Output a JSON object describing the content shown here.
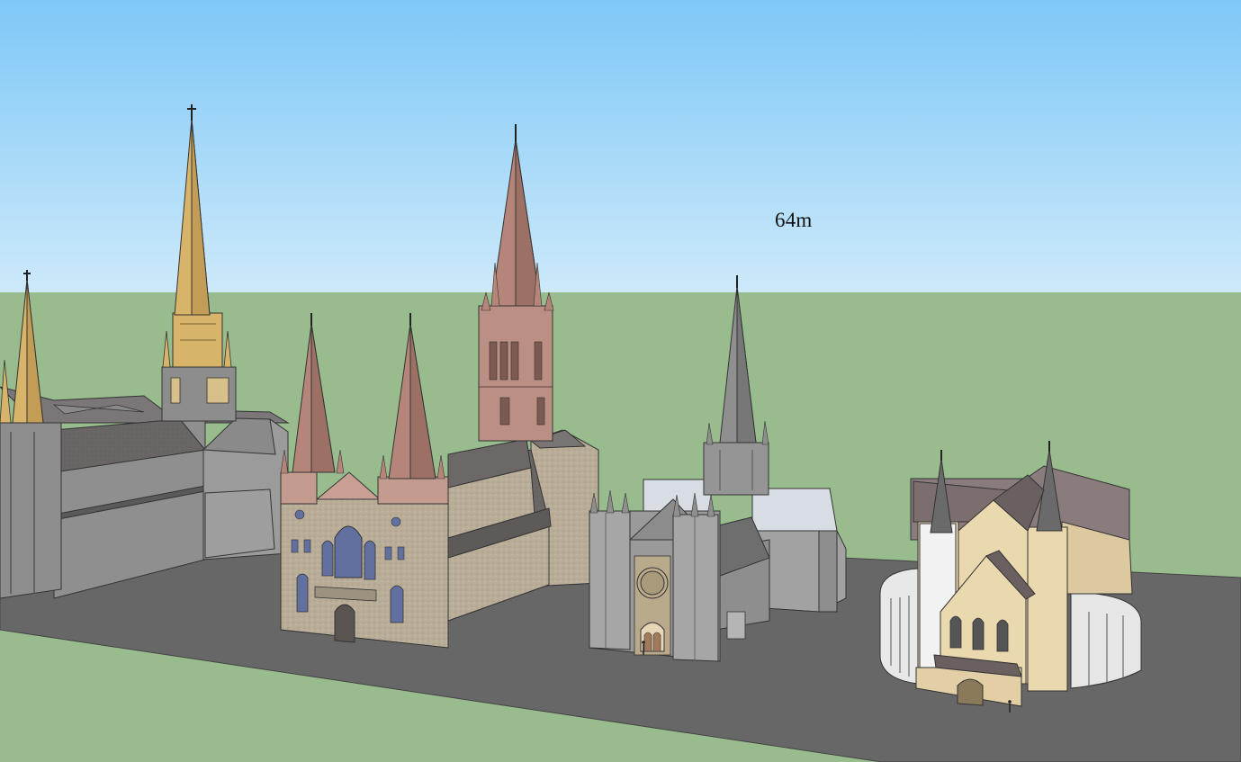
{
  "scene": {
    "height_label": "64m",
    "colors": {
      "sky_top": "#7ec8f8",
      "sky_bottom": "#c9e8fa",
      "ground": "#98bc8e",
      "road": "#666666",
      "stone_grey": "#9c9c9c",
      "roof_dark": "#5f5b5c",
      "spire_gold": "#d8b46a",
      "spire_rose": "#b48578",
      "cream": "#ead8ae"
    },
    "buildings": [
      {
        "name": "gold-spire-cathedral"
      },
      {
        "name": "twin-spire-rose-cathedral"
      },
      {
        "name": "grey-spire-cathedral"
      },
      {
        "name": "cream-cathedral"
      }
    ]
  }
}
